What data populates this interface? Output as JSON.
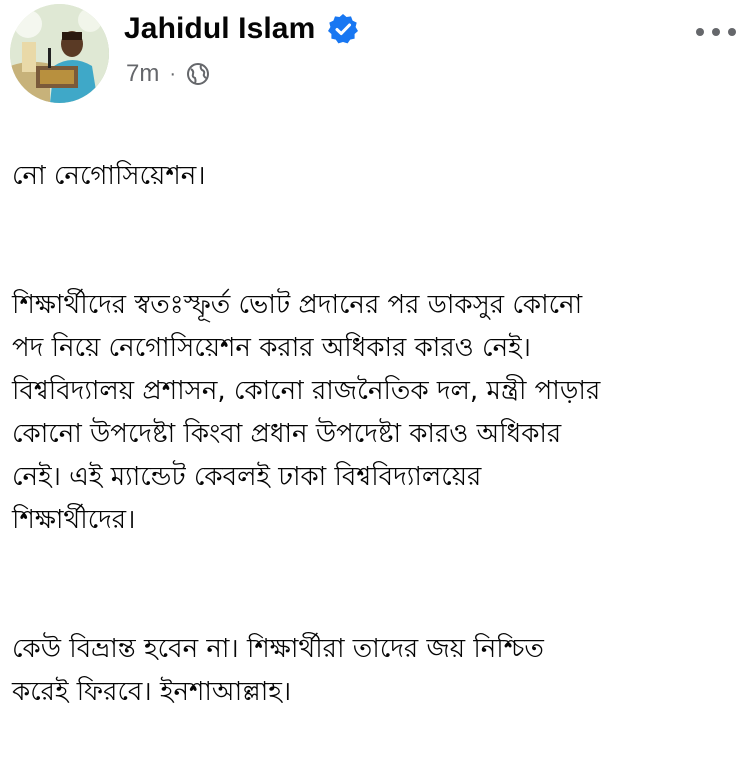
{
  "post": {
    "author": "Jahidul Islam",
    "time": "7m",
    "separator": "·",
    "verified_icon": "verified-badge-icon",
    "privacy_icon": "globe-icon",
    "more_icon": "more-horizontal-icon",
    "paragraphs": [
      "নো নেগোসিয়েশন।",
      "শিক্ষার্থীদের স্বতঃস্ফূর্ত ভোট প্রদানের পর ডাকসুর কোনো\nপদ নিয়ে নেগোসিয়েশন করার অধিকার কারও নেই।\nবিশ্ববিদ্যালয় প্রশাসন, কোনো রাজনৈতিক দল, মন্ত্রী পাড়ার\nকোনো উপদেষ্টা কিংবা প্রধান উপদেষ্টা কারও অধিকার\nনেই। এই ম্যান্ডেট কেবলই ঢাকা বিশ্ববিদ্যালয়ের\nশিক্ষার্থীদের।",
      "কেউ বিভ্রান্ত হবেন না। শিক্ষার্থীরা তাদের জয় নিশ্চিত\nকরেই ফিরবে। ইনশাআল্লাহ।"
    ]
  },
  "colors": {
    "text_primary": "#050505",
    "text_secondary": "#65676b",
    "verified_blue": "#1877f2",
    "background": "#ffffff"
  }
}
